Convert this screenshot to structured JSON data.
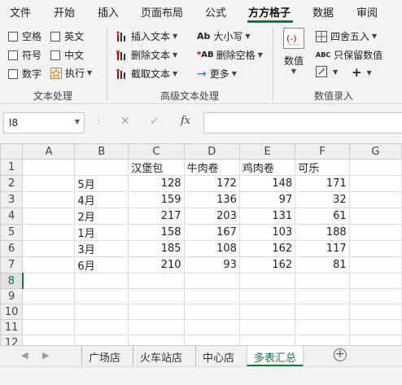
{
  "menu": {
    "tabs": [
      "文件",
      "开始",
      "插入",
      "页面布局",
      "公式",
      "方方格子",
      "数据",
      "审阅"
    ],
    "active": "方方格子"
  },
  "ribbon": {
    "text_group": {
      "checkboxes": [
        "空格",
        "英文",
        "符号",
        "中文",
        "数字"
      ],
      "execute": "执行",
      "label": "文本处理"
    },
    "advanced_group": {
      "insert_text": "插入文本",
      "delete_text": "删除文本",
      "cut_text": "截取文本",
      "uppercase": "大小写",
      "delete_spaces": "删除空格",
      "more": "更多",
      "label": "高级文本处理"
    },
    "number_group": {
      "numeric": "数值",
      "round": "四舍五入",
      "keep_numeric": "只保留数值",
      "label": "数值录入"
    }
  },
  "formula_bar": {
    "name_box": "I8",
    "fx": "fx",
    "formula": ""
  },
  "sheet": {
    "columns": [
      "A",
      "B",
      "C",
      "D",
      "E",
      "F",
      "G"
    ],
    "rows": [
      [
        "1",
        "",
        "",
        "汉堡包",
        "牛肉卷",
        "鸡肉卷",
        "可乐",
        ""
      ],
      [
        "2",
        "",
        "5月",
        "128",
        "172",
        "148",
        "171",
        ""
      ],
      [
        "3",
        "",
        "4月",
        "159",
        "136",
        "97",
        "32",
        ""
      ],
      [
        "4",
        "",
        "2月",
        "217",
        "203",
        "131",
        "61",
        ""
      ],
      [
        "5",
        "",
        "1月",
        "158",
        "167",
        "103",
        "188",
        ""
      ],
      [
        "6",
        "",
        "3月",
        "185",
        "108",
        "162",
        "117",
        ""
      ],
      [
        "7",
        "",
        "6月",
        "210",
        "93",
        "162",
        "81",
        ""
      ],
      [
        "8",
        "",
        "",
        "",
        "",
        "",
        "",
        ""
      ],
      [
        "9",
        "",
        "",
        "",
        "",
        "",
        "",
        ""
      ],
      [
        "10",
        "",
        "",
        "",
        "",
        "",
        "",
        ""
      ],
      [
        "11",
        "",
        "",
        "",
        "",
        "",
        "",
        ""
      ],
      [
        "12",
        "",
        "",
        "",
        "",
        "",
        "",
        ""
      ]
    ],
    "selected_row": "8"
  },
  "sheet_tabs": {
    "tabs": [
      "广场店",
      "火车站店",
      "中心店",
      "多表汇总"
    ],
    "active": "多表汇总"
  },
  "colors": {
    "accent": "#217346",
    "ribbon_bg": "#f3f3f3"
  }
}
